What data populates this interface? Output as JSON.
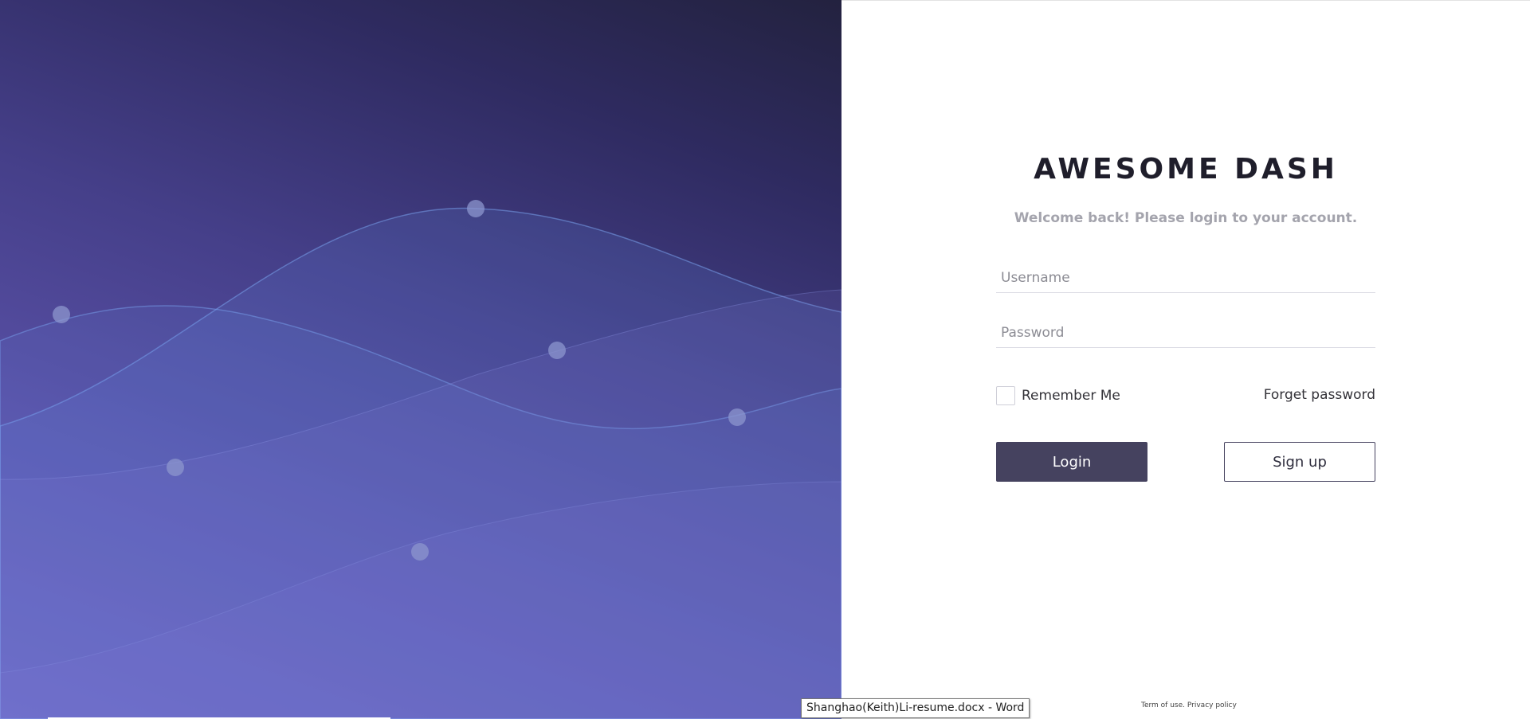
{
  "brand": {
    "title": "AWESOME DASH"
  },
  "login": {
    "welcome": "Welcome back! Please login to your account.",
    "username_placeholder": "Username",
    "password_placeholder": "Password",
    "remember_label": "Remember Me",
    "forget_label": "Forget password",
    "login_button": "Login",
    "signup_button": "Sign up"
  },
  "footer": {
    "terms": "Term of use.",
    "privacy": "Privacy policy"
  },
  "tooltip": {
    "text": "Shanghao(Keith)Li-resume.docx - Word"
  },
  "colors": {
    "hero_gradient": [
      "#6d62bf",
      "#453f89",
      "#23223f"
    ],
    "button_primary": "#45425f",
    "title_text": "#1f1e2b",
    "muted_text": "#a4a4ad"
  }
}
